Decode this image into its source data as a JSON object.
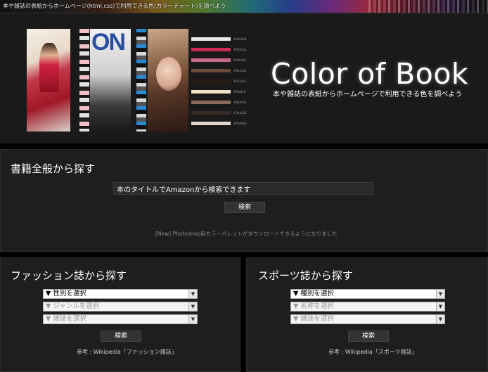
{
  "browser_title": "本や雑誌の表紙からホームページ(html,css)で利用できる色(カラーチャート)を調べよう",
  "hero": {
    "cover2_logo": "ON",
    "brand": "Color of Book",
    "tagline": "本や雑誌の表紙からホームページで利用できる色を調べよう",
    "swatch_colors": [
      "#e8e8e8",
      "#d02a5a",
      "#c86a8a",
      "#6a4a3a",
      "#2a1a14",
      "#f0e0c8",
      "#8a6a5a",
      "#3a2a28",
      "#e0d8d0"
    ],
    "swatch_codes": [
      "#e8e8e8",
      "#d02a5a",
      "#c86a8a",
      "#6a4a3a",
      "#2a1a14",
      "#f0e0c8",
      "#8a6a5a",
      "#3a2a28",
      "#e0d8d0"
    ]
  },
  "book_search": {
    "title": "書籍全般から探す",
    "input_value": "本のタイトルでAmazonから検索できます",
    "button": "検索",
    "notice": "[New] Photoshop用カラーパレットがダウンロードできるようになりました"
  },
  "fashion": {
    "title": "ファッション誌から探す",
    "select_gender": "▼ 性別を選択",
    "select_genre": "▼ ジャンルを選択",
    "select_magazine": "▼ 雑誌を選択",
    "button": "検索",
    "ref_prefix": "参考 : Wikipedia",
    "ref_link": "「ファッション雑誌」"
  },
  "sports": {
    "title": "スポーツ誌から探す",
    "select_type": "▼ 種別を選択",
    "select_name": "▼ 名称を選択",
    "select_magazine": "▼ 雑誌を選択",
    "button": "検索",
    "ref_prefix": "参考 : Wikipedia",
    "ref_link": "「スポーツ雑誌」"
  }
}
